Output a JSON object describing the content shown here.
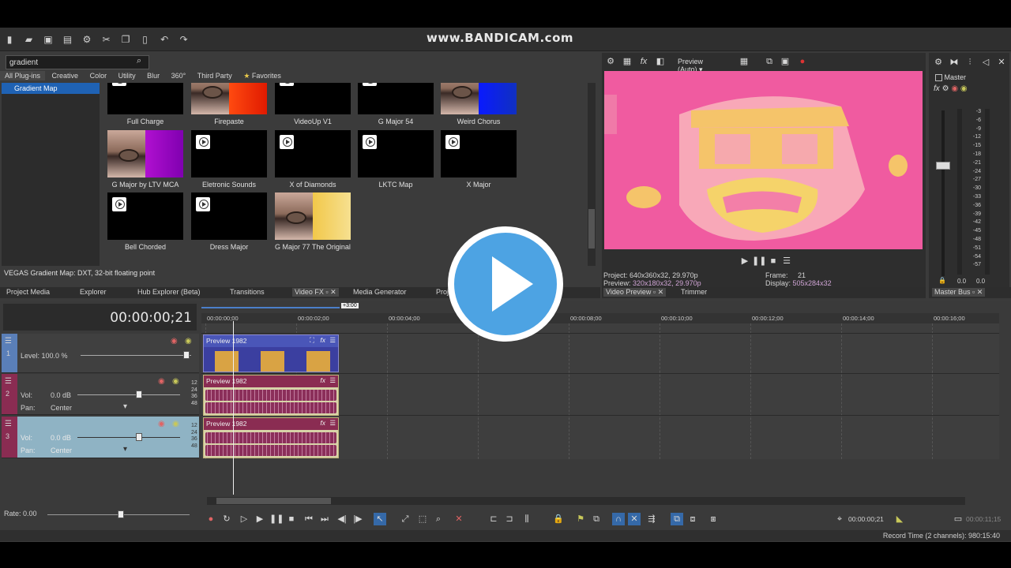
{
  "watermark": "www.BANDICAM.com",
  "search": {
    "value": "gradient"
  },
  "plugin_tabs": [
    "All Plug-ins",
    "Creative",
    "Color",
    "Utility",
    "Blur",
    "360°",
    "Third Party",
    "Favorites"
  ],
  "tree": {
    "selected": "Gradient Map"
  },
  "plugins": [
    {
      "label": "Full Charge",
      "thumb": "video"
    },
    {
      "label": "Firepaste",
      "thumb": "eye-orange"
    },
    {
      "label": "VideoUp V1",
      "thumb": "video"
    },
    {
      "label": "G Major 54",
      "thumb": "video"
    },
    {
      "label": "Weird Chorus",
      "thumb": "eye-blue"
    },
    {
      "label": "G Major by LTV MCA",
      "thumb": "eye-magenta"
    },
    {
      "label": "Eletronic Sounds",
      "thumb": "video"
    },
    {
      "label": "X of Diamonds",
      "thumb": "video"
    },
    {
      "label": "LKTC Map",
      "thumb": "video"
    },
    {
      "label": "X Major",
      "thumb": "video"
    },
    {
      "label": "Bell Chorded",
      "thumb": "video"
    },
    {
      "label": "Dress Major",
      "thumb": "video"
    },
    {
      "label": "G Major 77 The Original",
      "thumb": "eye-yellow"
    }
  ],
  "plugin_description": "VEGAS Gradient Map: DXT, 32-bit floating point",
  "dock_tabs": [
    "Project Media",
    "Explorer",
    "Hub Explorer (Beta)",
    "Transitions",
    "Video FX",
    "Media Generator",
    "Proj"
  ],
  "preview": {
    "mode": "Preview (Auto)",
    "project_label": "Project:",
    "project_value": "640x360x32, 29.970p",
    "preview_label": "Preview:",
    "preview_value": "320x180x32, 29.970p",
    "frame_label": "Frame:",
    "frame_value": "21",
    "display_label": "Display:",
    "display_value": "505x284x32",
    "tabs": [
      "Video Preview",
      "Trimmer"
    ]
  },
  "master": {
    "label": "Master",
    "meter_scale": [
      "-3",
      "-6",
      "-9",
      "-12",
      "-15",
      "-18",
      "-21",
      "-24",
      "-27",
      "-30",
      "-33",
      "-36",
      "-39",
      "-42",
      "-45",
      "-48",
      "-51",
      "-54",
      "-57"
    ],
    "readout_left": "0.0",
    "readout_right": "0.0",
    "tab": "Master Bus"
  },
  "timeline": {
    "time": "00:00:00;21",
    "region_badge": "+3:00",
    "ruler": [
      "00:00:00;00",
      "00:00:02;00",
      "00:00:04;00",
      "00:00:06;00",
      "00:00:08;00",
      "00:00:10;00",
      "00:00:12;00",
      "00:00:14;00",
      "00:00:16;00"
    ],
    "tracks": [
      {
        "num": "1",
        "kind": "video",
        "level": "Level: 100.0 %"
      },
      {
        "num": "2",
        "kind": "audio",
        "vol_label": "Vol:",
        "vol": "0.0 dB",
        "pan_label": "Pan:",
        "pan": "Center"
      },
      {
        "num": "3",
        "kind": "audio",
        "vol_label": "Vol:",
        "vol": "0.0 dB",
        "pan_label": "Pan:",
        "pan": "Center"
      }
    ],
    "db_scale": [
      "12",
      "24",
      "36",
      "48"
    ],
    "clips": [
      "Preview 1982",
      "Preview 1982",
      "Preview 1982"
    ],
    "rate": "Rate: 0.00",
    "cursor_time": "00:00:00;21",
    "end_time": "00:00:11;15"
  },
  "status": "Record Time (2 channels): 980:15:40",
  "colors": {
    "accent": "#1f62b4",
    "preview_bg": "#f05ba0",
    "face": "#f5d36a",
    "audio_track": "#8a2c52",
    "overlay_play": "#4da3e3"
  }
}
